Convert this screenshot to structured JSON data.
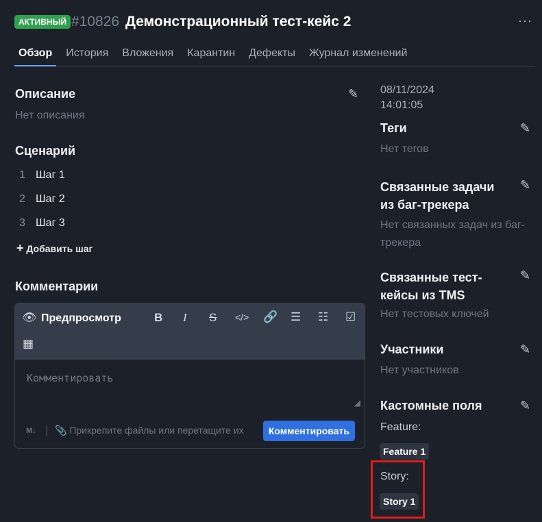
{
  "header": {
    "status": "АКТИВНЫЙ",
    "id": "#10826",
    "title": "Демонстрационный тест-кейс 2",
    "more": "···"
  },
  "tabs": [
    "Обзор",
    "История",
    "Вложения",
    "Карантин",
    "Дефекты",
    "Журнал изменений"
  ],
  "description": {
    "title": "Описание",
    "value": "Нет описания"
  },
  "scenario": {
    "title": "Сценарий",
    "steps": [
      {
        "n": "1",
        "text": "Шаг 1"
      },
      {
        "n": "2",
        "text": "Шаг 2"
      },
      {
        "n": "3",
        "text": "Шаг 3"
      }
    ],
    "add": "Добавить шаг"
  },
  "comments": {
    "title": "Комментарии",
    "preview": "Предпросмотр",
    "placeholder": "Комментировать",
    "attach": "Прикрепите файлы или перетащите их",
    "submit": "Комментировать"
  },
  "sidebar": {
    "date": "08/11/2024",
    "time": "14:01:05",
    "tags": {
      "title": "Теги",
      "value": "Нет тегов"
    },
    "issues": {
      "title1": "Связанные задачи",
      "title2": "из баг-трекера",
      "value1": "Нет связанных задач из баг-",
      "value2": "трекера"
    },
    "tms": {
      "title1": "Связанные тест-",
      "title2": "кейсы из TMS",
      "value": "Нет тестовых ключей"
    },
    "members": {
      "title": "Участники",
      "value": "Нет участников"
    },
    "custom": {
      "title": "Кастомные поля",
      "feature_label": "Feature:",
      "feature_value": "Feature 1",
      "story_label": "Story:",
      "story_value": "Story 1"
    }
  },
  "colors": {
    "accent": "#2f6fe0",
    "status": "#2ea24f",
    "highlight": "#e21b1b"
  }
}
